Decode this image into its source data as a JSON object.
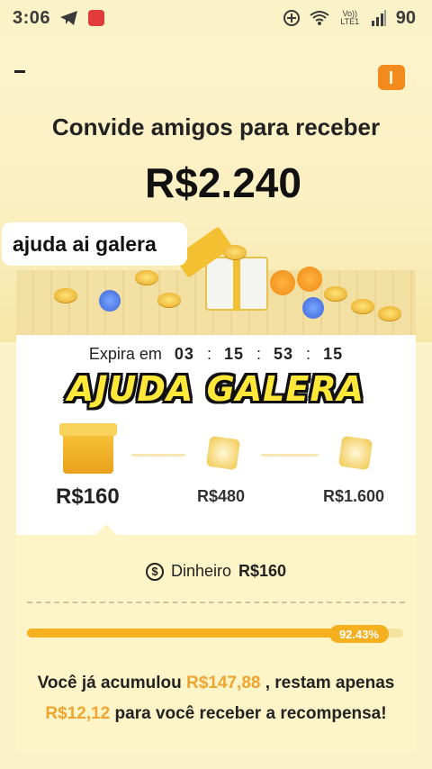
{
  "status_bar": {
    "time": "3:06",
    "battery": "90",
    "network_label": "Vo)) LTE1"
  },
  "header": {
    "menu_symbol": "-",
    "headline": "Convide amigos para receber",
    "amount": "R$2.240"
  },
  "chat_bubble": "ajuda ai galera",
  "expiry": {
    "label": "Expira em",
    "hours": "03",
    "minutes": "15",
    "seconds": "53",
    "fraction": "15",
    "sep": ":"
  },
  "overlay_text": "AJUDA GALERA",
  "steps": [
    {
      "amount": "R$160"
    },
    {
      "amount": "R$480"
    },
    {
      "amount": "R$1.600"
    }
  ],
  "cash": {
    "symbol": "$",
    "label": "Dinheiro",
    "amount": "R$160"
  },
  "progress": {
    "percent_label": "92.43%",
    "fraction": 0.9243
  },
  "message": {
    "part1": "Você já acumulou ",
    "accumulated": "R$147,88",
    "part2": " , restam apenas",
    "remaining": "R$12,12",
    "part3": " para você receber a recompensa!"
  },
  "colors": {
    "accent": "#f4b01f",
    "highlight": "#f0a531",
    "background": "#fbf3c8",
    "ticket": "#f28a1e"
  }
}
